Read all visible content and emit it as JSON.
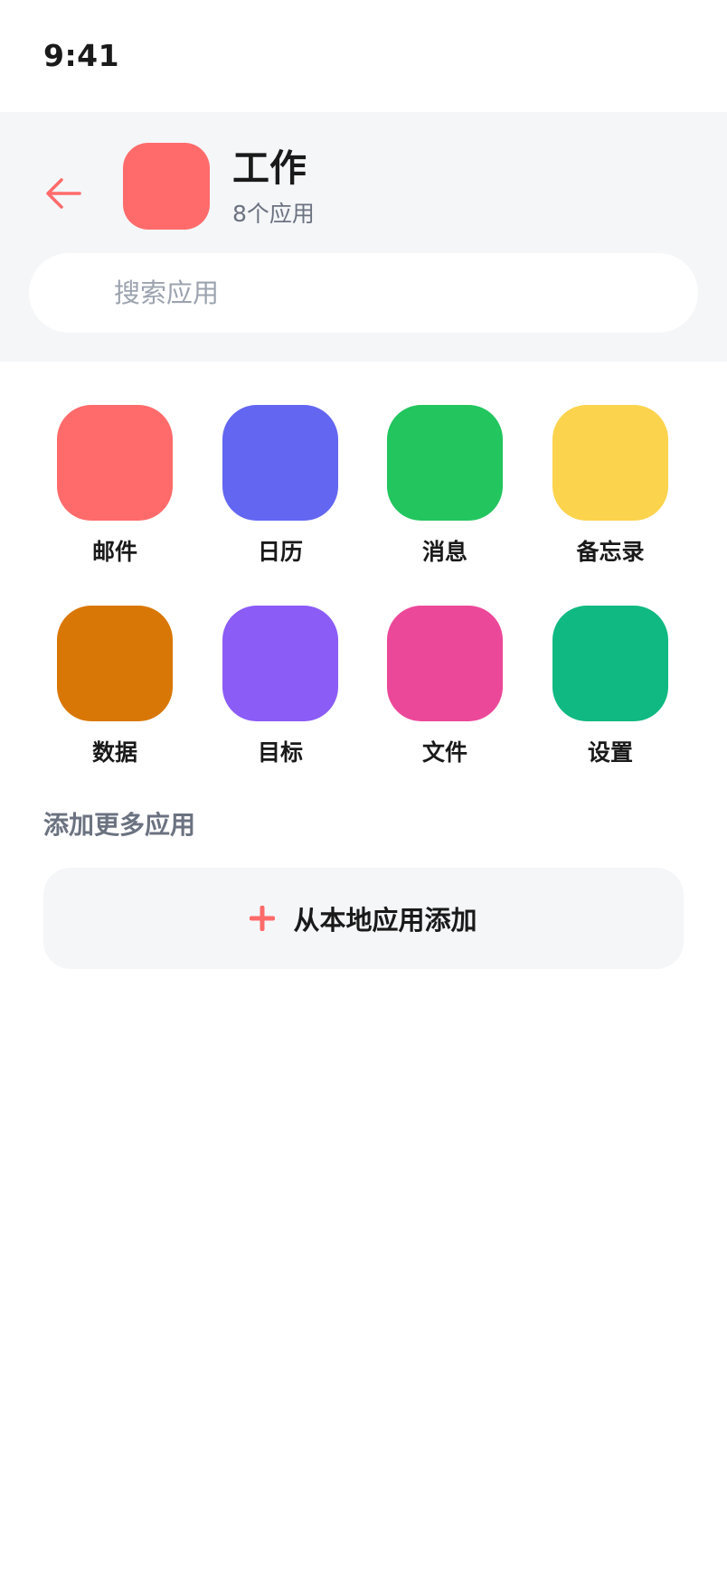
{
  "status_bar": {
    "time": "9:41"
  },
  "header": {
    "back_icon": "arrow-left-icon",
    "folder_color": "#ff6b6b",
    "title": "工作",
    "subtitle": "8个应用"
  },
  "search": {
    "placeholder": "搜索应用",
    "value": ""
  },
  "apps": [
    {
      "label": "邮件",
      "color": "#ff6b6b"
    },
    {
      "label": "日历",
      "color": "#6366f1"
    },
    {
      "label": "消息",
      "color": "#22c55e"
    },
    {
      "label": "备忘录",
      "color": "#fcd34d"
    },
    {
      "label": "数据",
      "color": "#d97706"
    },
    {
      "label": "目标",
      "color": "#8b5cf6"
    },
    {
      "label": "文件",
      "color": "#ec4899"
    },
    {
      "label": "设置",
      "color": "#10b981"
    }
  ],
  "add_more": {
    "section_title": "添加更多应用",
    "button_label": "从本地应用添加",
    "button_icon": "plus-icon",
    "accent_color": "#ff6b6b"
  }
}
